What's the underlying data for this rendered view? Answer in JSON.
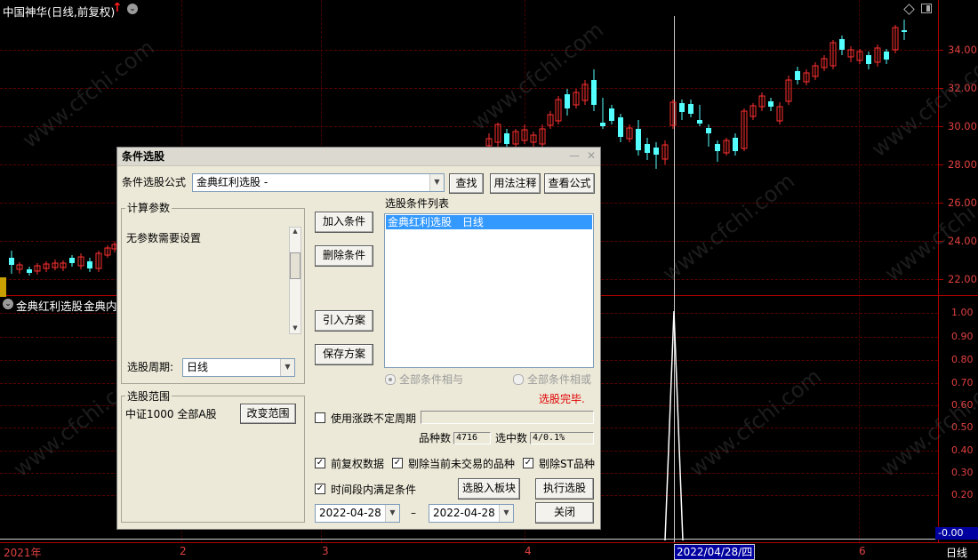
{
  "chart_header": {
    "title": "中国神华(日线,前复权)",
    "up_arrow": "↑",
    "menu_icon": "⌄"
  },
  "price_axis": {
    "labels": [
      "34.00",
      "32.00",
      "30.00",
      "28.00",
      "26.00",
      "24.00",
      "22.00"
    ]
  },
  "indicator_header": {
    "text1": "金典红利选股",
    "text2": "金典内"
  },
  "indicator_axis": {
    "labels": [
      "1.00",
      "0.90",
      "0.80",
      "0.70",
      "0.60",
      "0.50",
      "0.40",
      "0.30",
      "0.20"
    ],
    "current_value": "-0.00"
  },
  "time_axis": {
    "labels": [
      "2021年",
      "2",
      "3",
      "4",
      "6"
    ],
    "cursor_date": "2022/04/28/四",
    "period": "日线"
  },
  "watermark": "www.cfchi.com",
  "colors": {
    "up": "#ff3030",
    "down": "#54ffff",
    "axis": "#b00000",
    "axis_text": "#e04040"
  },
  "dialog": {
    "title": "条件选股",
    "title_controls": {
      "minimize": "—",
      "close": "✕"
    },
    "formula_label": "条件选股公式",
    "formula_value": "金典红利选股 -",
    "btn_find": "查找",
    "btn_usage": "用法注释",
    "btn_view": "查看公式",
    "params_group": "计算参数",
    "params_text": "无参数需要设置",
    "period_label": "选股周期:",
    "period_value": "日线",
    "range_group": "选股范围",
    "range_text": "中证1000 全部A股",
    "btn_change_range": "改变范围",
    "btn_add": "加入条件",
    "btn_delete": "删除条件",
    "btn_import": "引入方案",
    "btn_save": "保存方案",
    "list_label": "选股条件列表",
    "list_items": [
      {
        "name": "金典红利选股",
        "period": "日线"
      }
    ],
    "radio_and": "全部条件相与",
    "radio_or": "全部条件相或",
    "status": "选股完毕.",
    "chk_variable_period": "使用涨跌不定周期",
    "count_label": "品种数",
    "count_value": "4716",
    "selected_label": "选中数",
    "selected_value": "4/0.1%",
    "chk_adjusted": "前复权数据",
    "chk_exclude_untraded": "剔除当前未交易的品种",
    "chk_exclude_st": "剔除ST品种",
    "chk_period_satisfy": "时间段内满足条件",
    "btn_to_block": "选股入板块",
    "btn_execute": "执行选股",
    "date_from": "2022-04-28",
    "date_sep": "–",
    "date_to": "2022-04-28",
    "btn_close": "关闭"
  }
}
